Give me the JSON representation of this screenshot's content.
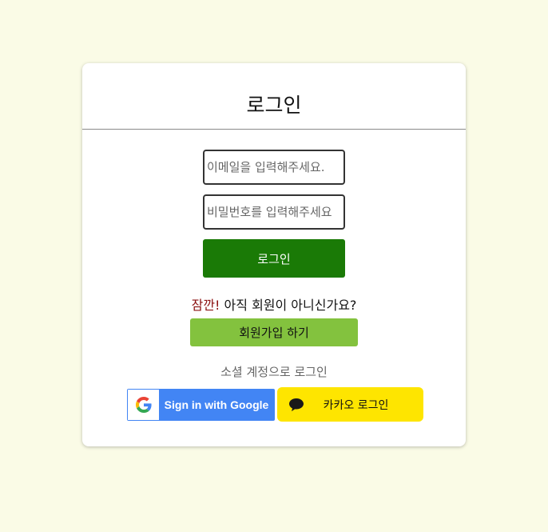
{
  "login": {
    "title": "로그인",
    "email_placeholder": "이메일을 입력해주세요.",
    "password_placeholder": "비밀번호를 입력해주세요",
    "login_button": "로그인"
  },
  "signup": {
    "question_accent": "잠깐!",
    "question_text": " 아직 회원이 아니신가요?",
    "button": "회원가입 하기"
  },
  "social": {
    "label": "소셜 계정으로 로그인",
    "google": {
      "label": "Sign in with Google",
      "icon": "google-logo-icon",
      "color": "#4285f4"
    },
    "kakao": {
      "label": "카카오 로그인",
      "icon": "speech-bubble-icon",
      "color": "#fee500"
    }
  },
  "colors": {
    "background": "#fafbe6",
    "login_button": "#1a7a06",
    "signup_button": "#83c23e",
    "accent": "#8b1010"
  }
}
